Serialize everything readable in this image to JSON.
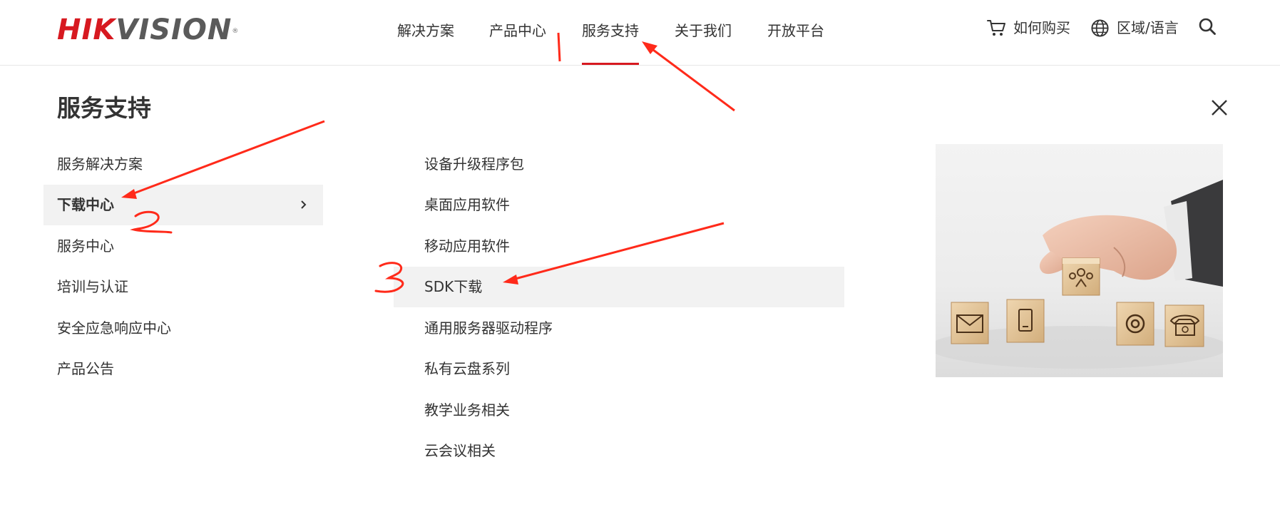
{
  "header": {
    "logo_text_red": "HIK",
    "logo_text_grey": "VISION",
    "logo_reg": "®",
    "nav": [
      "解决方案",
      "产品中心",
      "服务支持",
      "关于我们",
      "开放平台"
    ],
    "active_nav": "服务支持",
    "how_to_buy": "如何购买",
    "region_language": "区域/语言"
  },
  "panel": {
    "title": "服务支持",
    "left_menu": [
      "服务解决方案",
      "下载中心",
      "服务中心",
      "培训与认证",
      "安全应急响应中心",
      "产品公告"
    ],
    "left_active": "下载中心",
    "sub_menu": [
      "设备升级程序包",
      "桌面应用软件",
      "移动应用软件",
      "SDK下载",
      "通用服务器驱动程序",
      "私有云盘系列",
      "教学业务相关",
      "云会议相关"
    ],
    "sub_active": "SDK下载"
  },
  "icons": {
    "cart": "cart-icon",
    "globe": "globe-icon",
    "search": "search-icon",
    "close": "close-icon",
    "chevron": "chevron-right-icon"
  },
  "annotations": {
    "step_1": "1",
    "step_2": "2",
    "step_3": "3"
  },
  "colors": {
    "brand_red": "#d71920",
    "annotation_red": "#ff2a1a",
    "text": "#333333",
    "active_bg": "#f2f2f2"
  }
}
